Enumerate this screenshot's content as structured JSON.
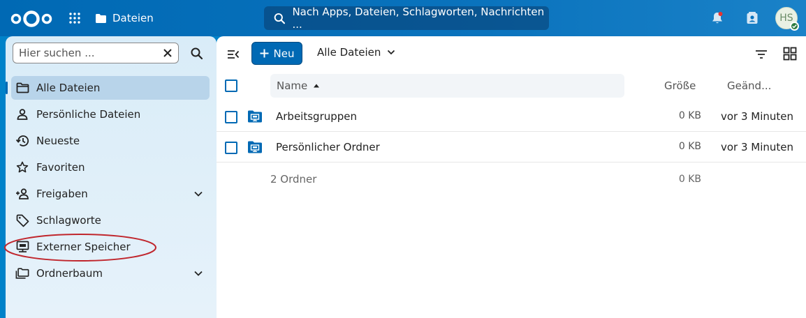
{
  "header": {
    "app_name": "Dateien",
    "search_placeholder": "Nach Apps, Dateien, Schlagworten, Nachrichten ...",
    "avatar_initials": "HS"
  },
  "sidebar": {
    "filter_placeholder": "Hier suchen ...",
    "items": [
      {
        "label": "Alle Dateien",
        "icon": "folder-icon",
        "active": true
      },
      {
        "label": "Persönliche Dateien",
        "icon": "person-icon"
      },
      {
        "label": "Neueste",
        "icon": "history-icon"
      },
      {
        "label": "Favoriten",
        "icon": "star-icon"
      },
      {
        "label": "Freigaben",
        "icon": "share-icon",
        "expandable": true
      },
      {
        "label": "Schlagworte",
        "icon": "tag-icon"
      },
      {
        "label": "Externer Speicher",
        "icon": "monitor-icon",
        "highlighted": true
      },
      {
        "label": "Ordnerbaum",
        "icon": "folder-multiple-icon",
        "expandable": true
      }
    ]
  },
  "main": {
    "new_label": "Neu",
    "breadcrumb": "Alle Dateien",
    "columns": {
      "name": "Name",
      "size": "Größe",
      "modified": "Geänd..."
    },
    "files": [
      {
        "name": "Arbeitsgruppen",
        "size": "0 KB",
        "modified": "vor 3 Minuten"
      },
      {
        "name": "Persönlicher Ordner",
        "size": "0 KB",
        "modified": "vor 3 Minuten"
      }
    ],
    "summary": {
      "count": "2 Ordner",
      "size": "0 KB"
    }
  },
  "colors": {
    "primary": "#0069b4",
    "header_bg": "#0069b4",
    "sidebar_bg": "#dcedf9",
    "active_item_bg": "#b8d4ea",
    "highlight_ellipse": "#c0262d"
  }
}
